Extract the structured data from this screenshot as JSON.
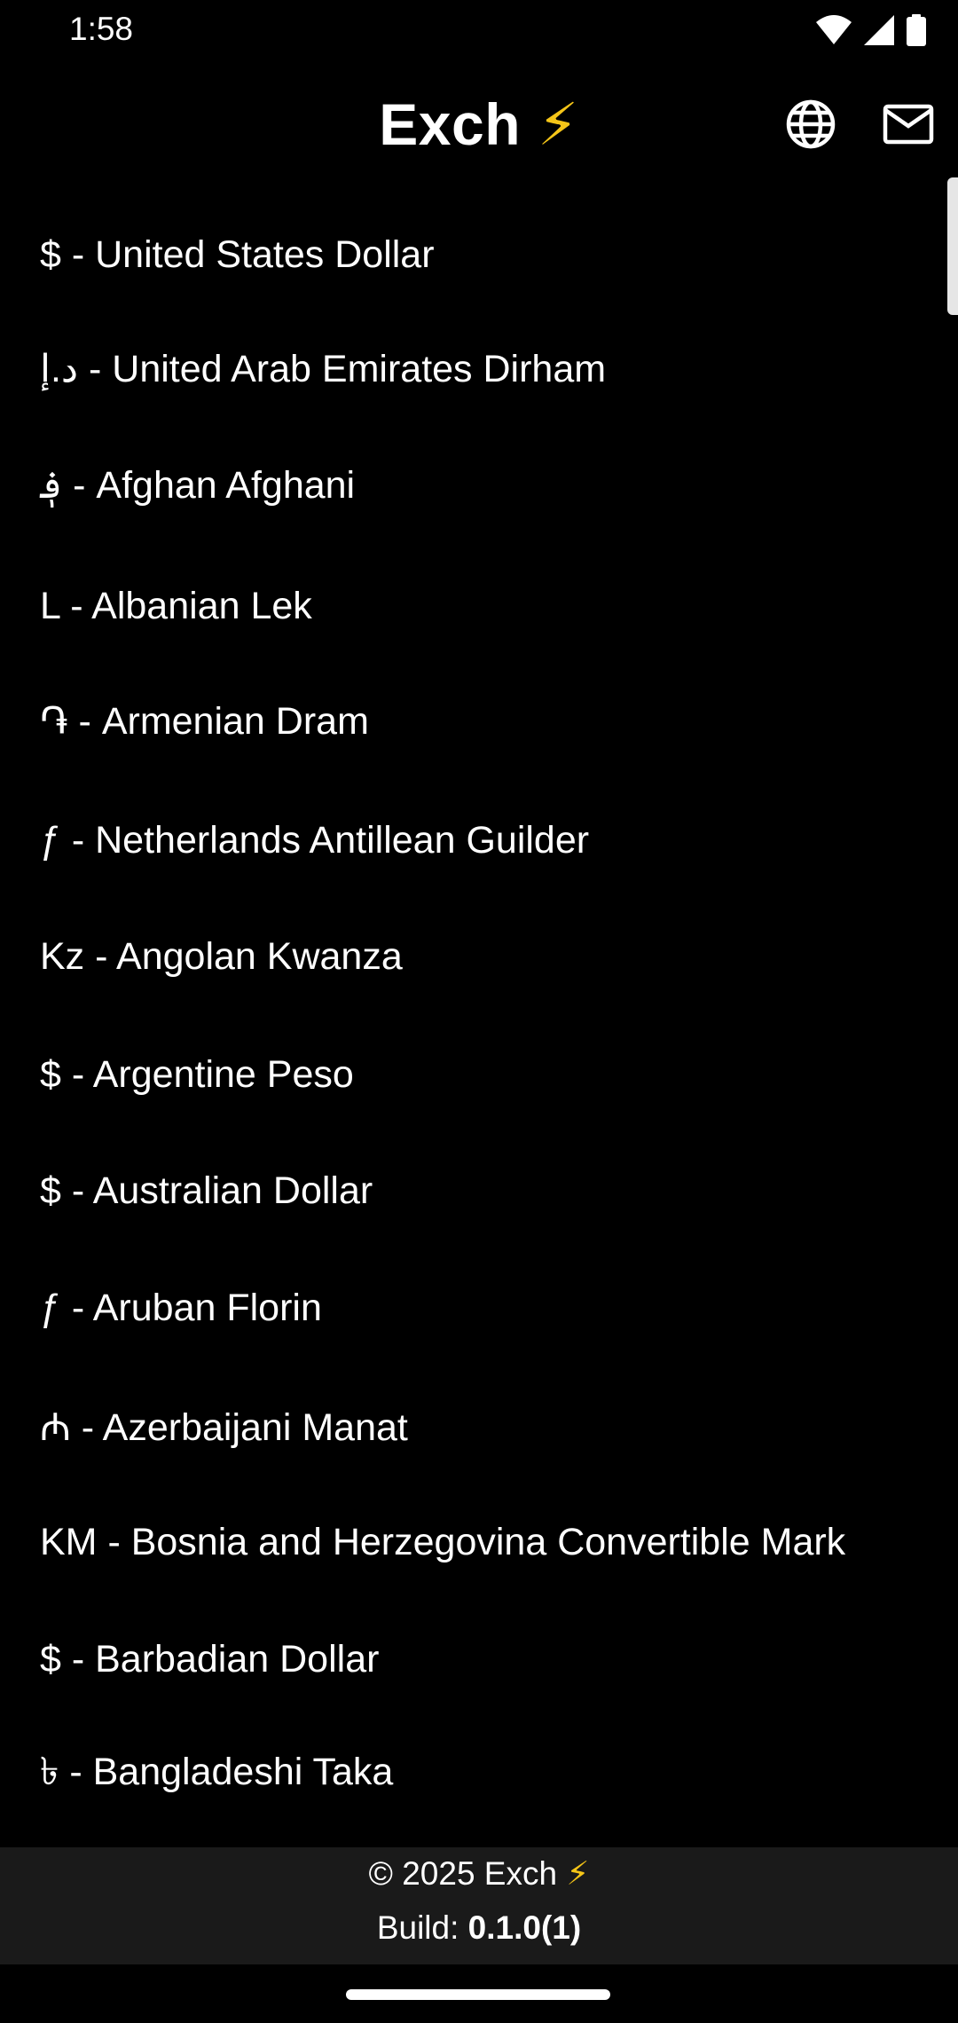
{
  "status_bar": {
    "time": "1:58",
    "icons": [
      "wifi-icon",
      "signal-icon",
      "battery-icon"
    ]
  },
  "app_bar": {
    "title": "Exch",
    "title_emoji": "⚡",
    "actions": [
      "globe-icon",
      "mail-icon"
    ]
  },
  "currencies": [
    {
      "label": "$ - United States Dollar"
    },
    {
      "label": "د.إ - United Arab Emirates Dirham"
    },
    {
      "label": "؋ - Afghan Afghani"
    },
    {
      "label": "L - Albanian Lek"
    },
    {
      "label": "֏ - Armenian Dram"
    },
    {
      "label": "ƒ - Netherlands Antillean Guilder"
    },
    {
      "label": "Kz - Angolan Kwanza"
    },
    {
      "label": "$ - Argentine Peso"
    },
    {
      "label": "$ - Australian Dollar"
    },
    {
      "label": "ƒ - Aruban Florin"
    },
    {
      "label": "₼ - Azerbaijani Manat"
    },
    {
      "label": "KM - Bosnia and Herzegovina Convertible Mark"
    },
    {
      "label": "$ - Barbadian Dollar"
    },
    {
      "label": "৳ - Bangladeshi Taka"
    }
  ],
  "footer": {
    "copyright": "© 2025 Exch",
    "emoji": "⚡",
    "build_label": "Build:",
    "build_version": "0.1.0(1)"
  },
  "colors": {
    "background": "#000000",
    "footer_background": "#1a1a1a",
    "text": "#ffffff",
    "bolt": "#f5c518"
  }
}
